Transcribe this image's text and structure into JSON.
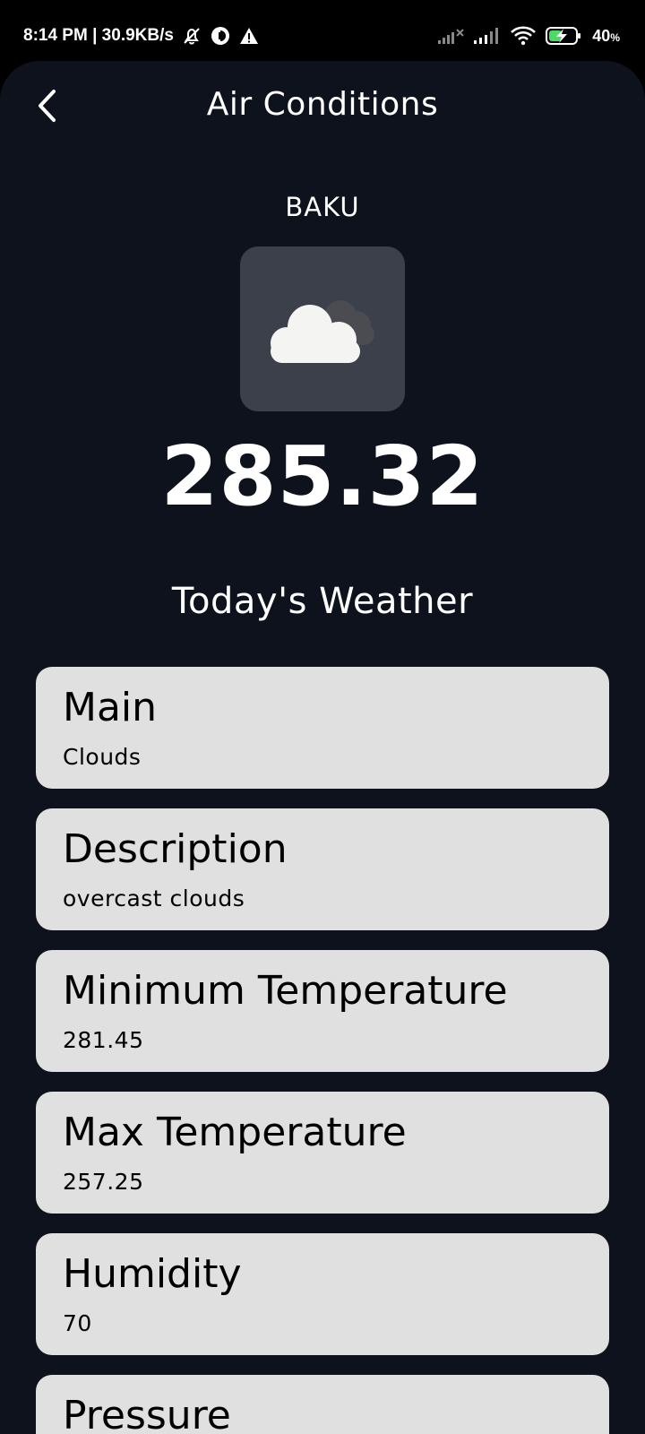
{
  "status_bar": {
    "time_info": "8:14 PM | 30.9KB/s",
    "battery": "40",
    "battery_unit": "%",
    "icons": [
      "mute-bell-icon",
      "circle-notification-icon",
      "warning-icon",
      "signal-x-icon",
      "signal-icon",
      "wifi-icon",
      "battery-charging-icon"
    ]
  },
  "header": {
    "title": "Air Conditions",
    "back_icon": "chevron-left-icon"
  },
  "city": "BAKU",
  "weather_icon": "cloud-icon",
  "temperature": "285.32",
  "section_title": "Today's Weather",
  "cards": [
    {
      "label": "Main",
      "value": "Clouds"
    },
    {
      "label": "Description",
      "value": "overcast clouds"
    },
    {
      "label": "Minimum Temperature",
      "value": "281.45"
    },
    {
      "label": "Max Temperature",
      "value": "257.25"
    },
    {
      "label": "Humidity",
      "value": "70"
    },
    {
      "label": "Pressure",
      "value": ""
    }
  ],
  "colors": {
    "background": "#0d121c",
    "card": "#e0e0e0",
    "tile": "#3b404b",
    "battery_accent": "#4cd964"
  }
}
